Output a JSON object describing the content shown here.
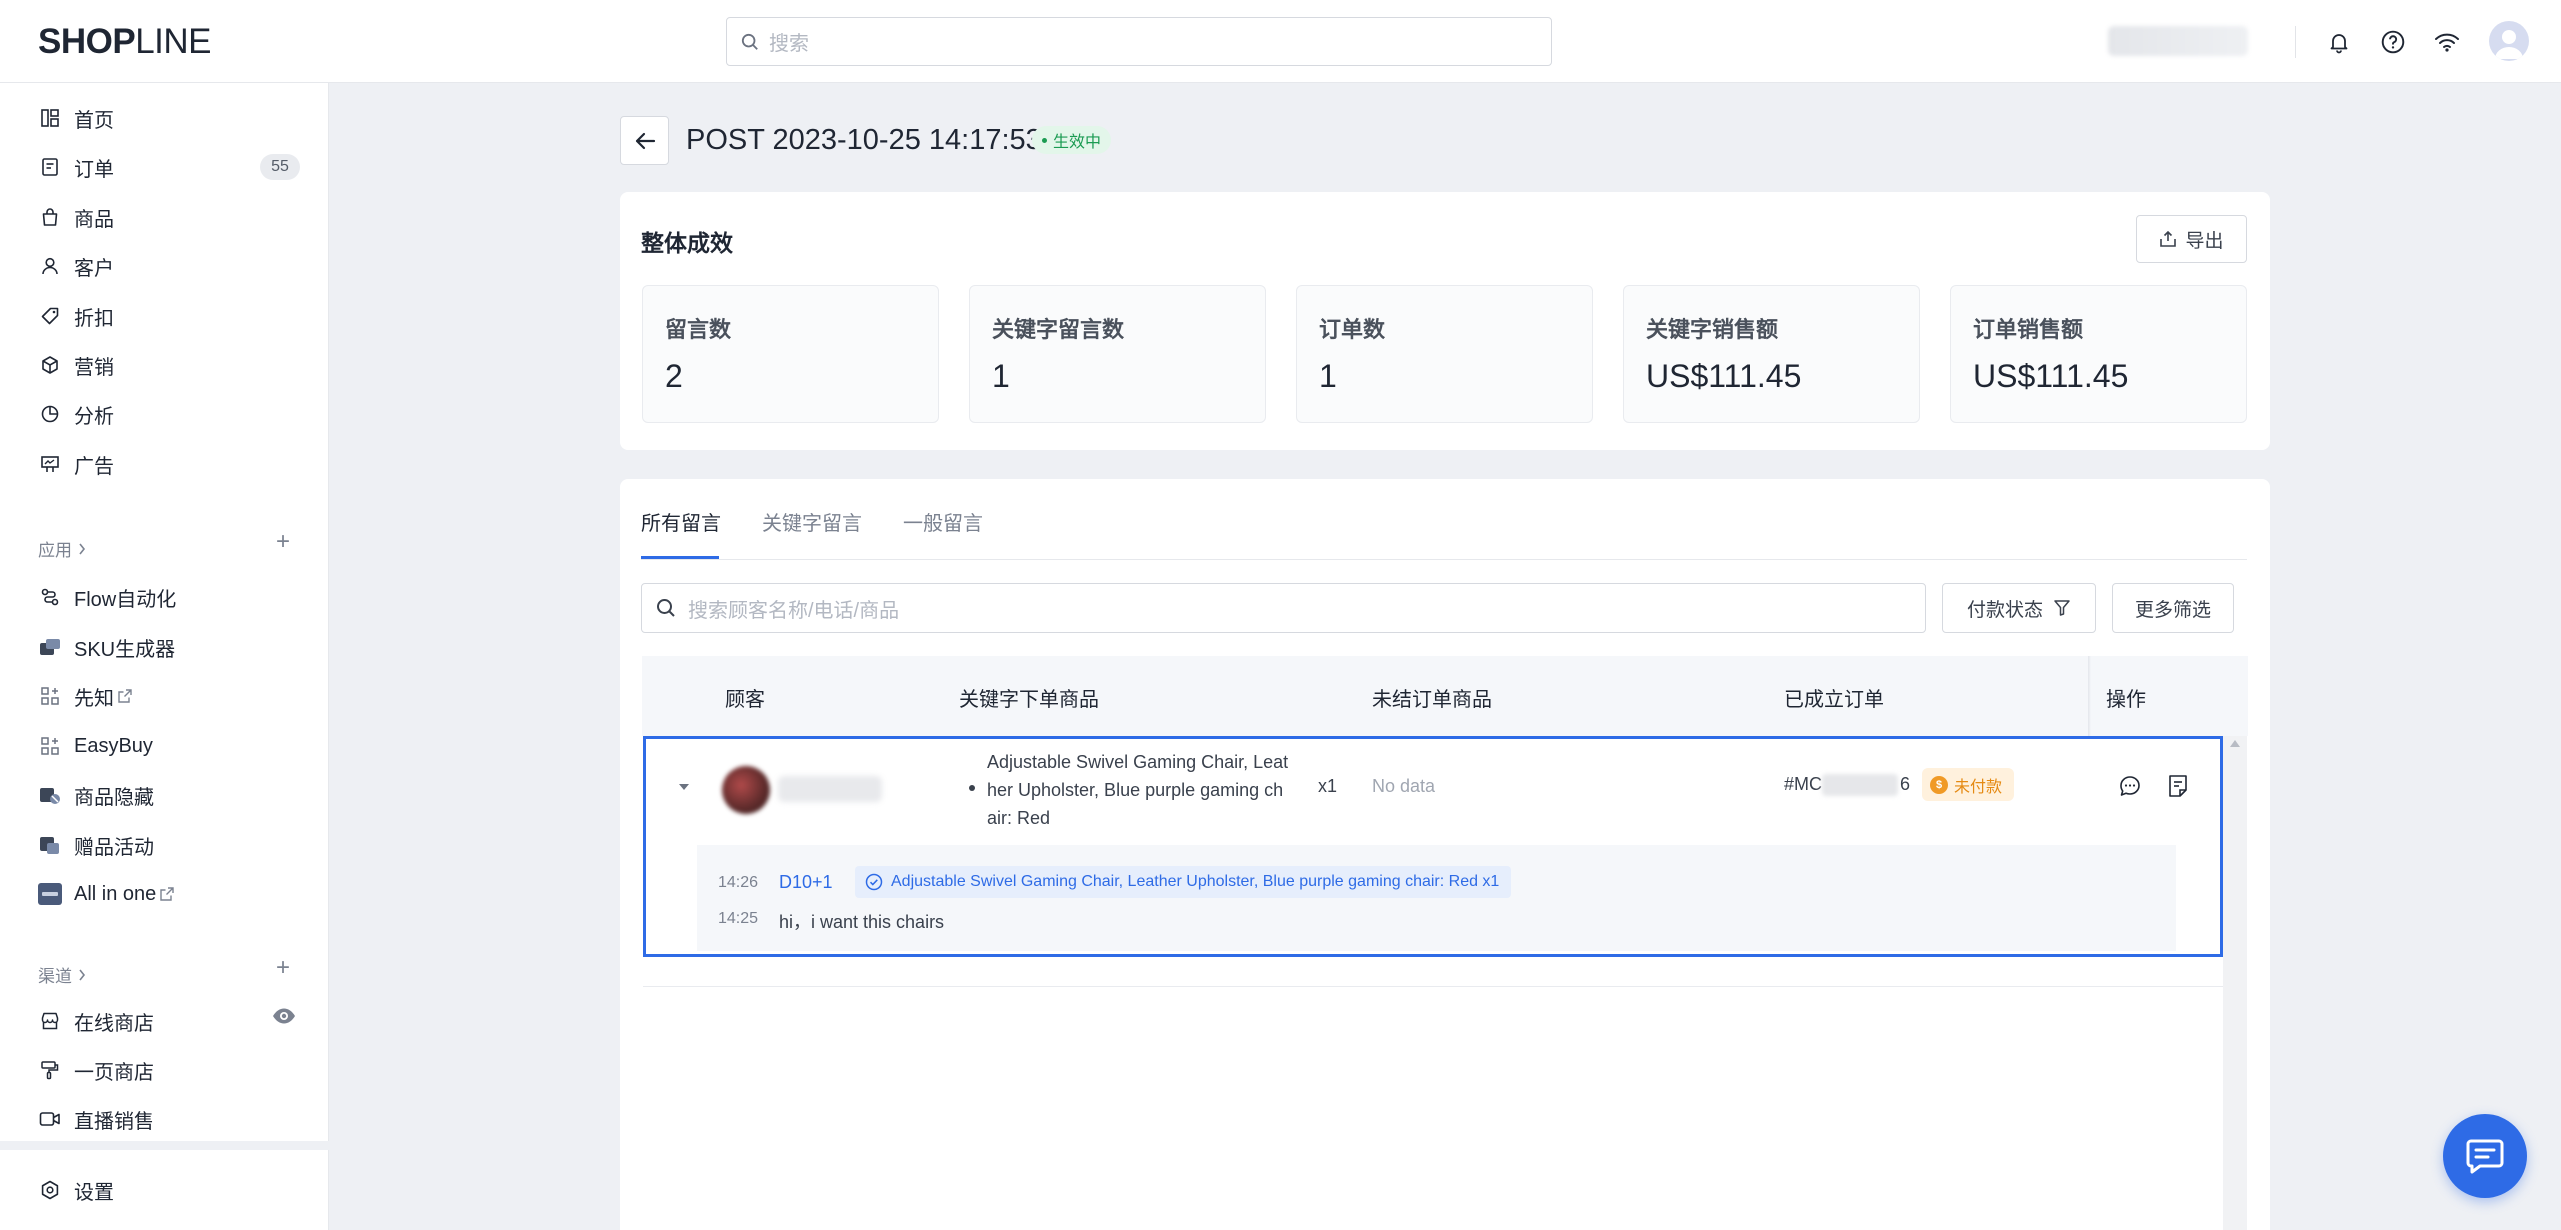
{
  "brand": {
    "logo_bold": "SHOP",
    "logo_light": "LINE"
  },
  "header": {
    "search_placeholder": "搜索"
  },
  "sidebar": {
    "main": [
      {
        "label": "首页",
        "icon": "dashboard-icon"
      },
      {
        "label": "订单",
        "icon": "order-icon",
        "badge": "55"
      },
      {
        "label": "商品",
        "icon": "bag-icon"
      },
      {
        "label": "客户",
        "icon": "user-icon"
      },
      {
        "label": "折扣",
        "icon": "tag-icon"
      },
      {
        "label": "营销",
        "icon": "box-icon"
      },
      {
        "label": "分析",
        "icon": "pie-icon"
      },
      {
        "label": "广告",
        "icon": "billboard-icon"
      }
    ],
    "apps_title": "应用",
    "apps": [
      {
        "label": "Flow自动化",
        "icon": "flow-icon"
      },
      {
        "label": "SKU生成器",
        "icon": "sku-icon"
      },
      {
        "label": "先知",
        "icon": "apps-icon"
      },
      {
        "label": "EasyBuy",
        "icon": "apps-icon"
      },
      {
        "label": "商品隐藏",
        "icon": "hide-icon"
      },
      {
        "label": "赠品活动",
        "icon": "gift-icon"
      },
      {
        "label": "All in one",
        "icon": "allinone-icon"
      }
    ],
    "channels_title": "渠道",
    "channels": [
      {
        "label": "在线商店",
        "icon": "store-icon"
      },
      {
        "label": "一页商店",
        "icon": "brush-icon"
      },
      {
        "label": "直播销售",
        "icon": "live-icon"
      }
    ],
    "settings": "设置"
  },
  "page": {
    "title": "POST 2023-10-25 14:17:53",
    "status": "生效中"
  },
  "performance": {
    "title": "整体成效",
    "export_label": "导出",
    "stats": [
      {
        "label": "留言数",
        "value": "2"
      },
      {
        "label": "关键字留言数",
        "value": "1"
      },
      {
        "label": "订单数",
        "value": "1"
      },
      {
        "label": "关键字销售额",
        "value": "US$111.45"
      },
      {
        "label": "订单销售额",
        "value": "US$111.45"
      }
    ]
  },
  "comments": {
    "tabs": [
      "所有留言",
      "关键字留言",
      "一般留言"
    ],
    "search_placeholder": "搜索顾客名称/电话/商品",
    "payment_filter": "付款状态",
    "more_filters": "更多筛选",
    "columns": [
      "顾客",
      "关键字下单商品",
      "未结订单商品",
      "已成立订单",
      "操作"
    ],
    "row": {
      "product_lines": [
        "Adjustable Swivel Gaming Chair, Leat",
        "her Upholster, Blue purple gaming ch",
        "air: Red"
      ],
      "qty": "x1",
      "pending": "No data",
      "order_prefix": "#MC",
      "order_suffix": "6",
      "payment_status": "未付款",
      "payment_coin": "$",
      "details": [
        {
          "time": "14:26",
          "keyword": "D10+1",
          "chip": "Adjustable Swivel Gaming Chair, Leather Upholster, Blue purple gaming chair: Red x1"
        },
        {
          "time": "14:25",
          "text": "hi，i want this chairs"
        }
      ]
    }
  },
  "colors": {
    "accent": "#2e6be6",
    "success": "#1b9b52",
    "warning": "#e58a13"
  }
}
